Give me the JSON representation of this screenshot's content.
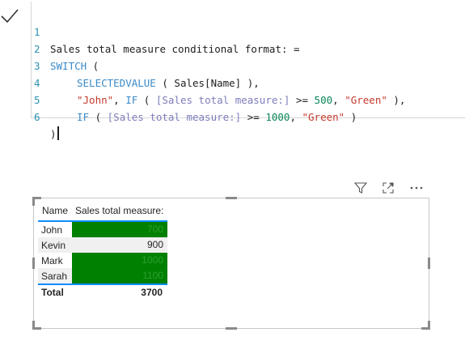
{
  "editor": {
    "lines": [
      {
        "num": "1",
        "text": "Sales total measure conditional format: ="
      },
      {
        "num": "2",
        "kw": "SWITCH",
        "rest": " ("
      },
      {
        "num": "3",
        "fn": "SELECTEDVALUE",
        "a": " ( ",
        "col": "Sales[Name]",
        "b": " ),"
      },
      {
        "num": "4",
        "s1": "\"John\"",
        "a": ", ",
        "fn": "IF",
        "b": " ( ",
        "col": "[Sales total measure:]",
        "c": " >= ",
        "n": "500",
        "d": ", ",
        "s2": "\"Green\"",
        "e": " ),"
      },
      {
        "num": "5",
        "fn": "IF",
        "b": " ( ",
        "col": "[Sales total measure:]",
        "c": " >= ",
        "n": "1000",
        "d": ", ",
        "s2": "\"Green\"",
        "e": " )"
      },
      {
        "num": "6",
        "text": ")"
      }
    ],
    "check_icon": "checkmark-icon"
  },
  "visual_header": {
    "icons": [
      "filter-icon",
      "focus-mode-icon",
      "more-options-icon"
    ]
  },
  "table": {
    "columns": [
      "Name",
      "Sales total measure:"
    ],
    "rows": [
      {
        "name": "John",
        "value": "700",
        "highlight": true
      },
      {
        "name": "Kevin",
        "value": "900",
        "highlight": false
      },
      {
        "name": "Mark",
        "value": "1000",
        "highlight": true
      },
      {
        "name": "Sarah",
        "value": "1100",
        "highlight": true
      }
    ],
    "total_label": "Total",
    "total_value": "3700",
    "highlight_color": "#008000",
    "accent_color": "#118dff"
  }
}
